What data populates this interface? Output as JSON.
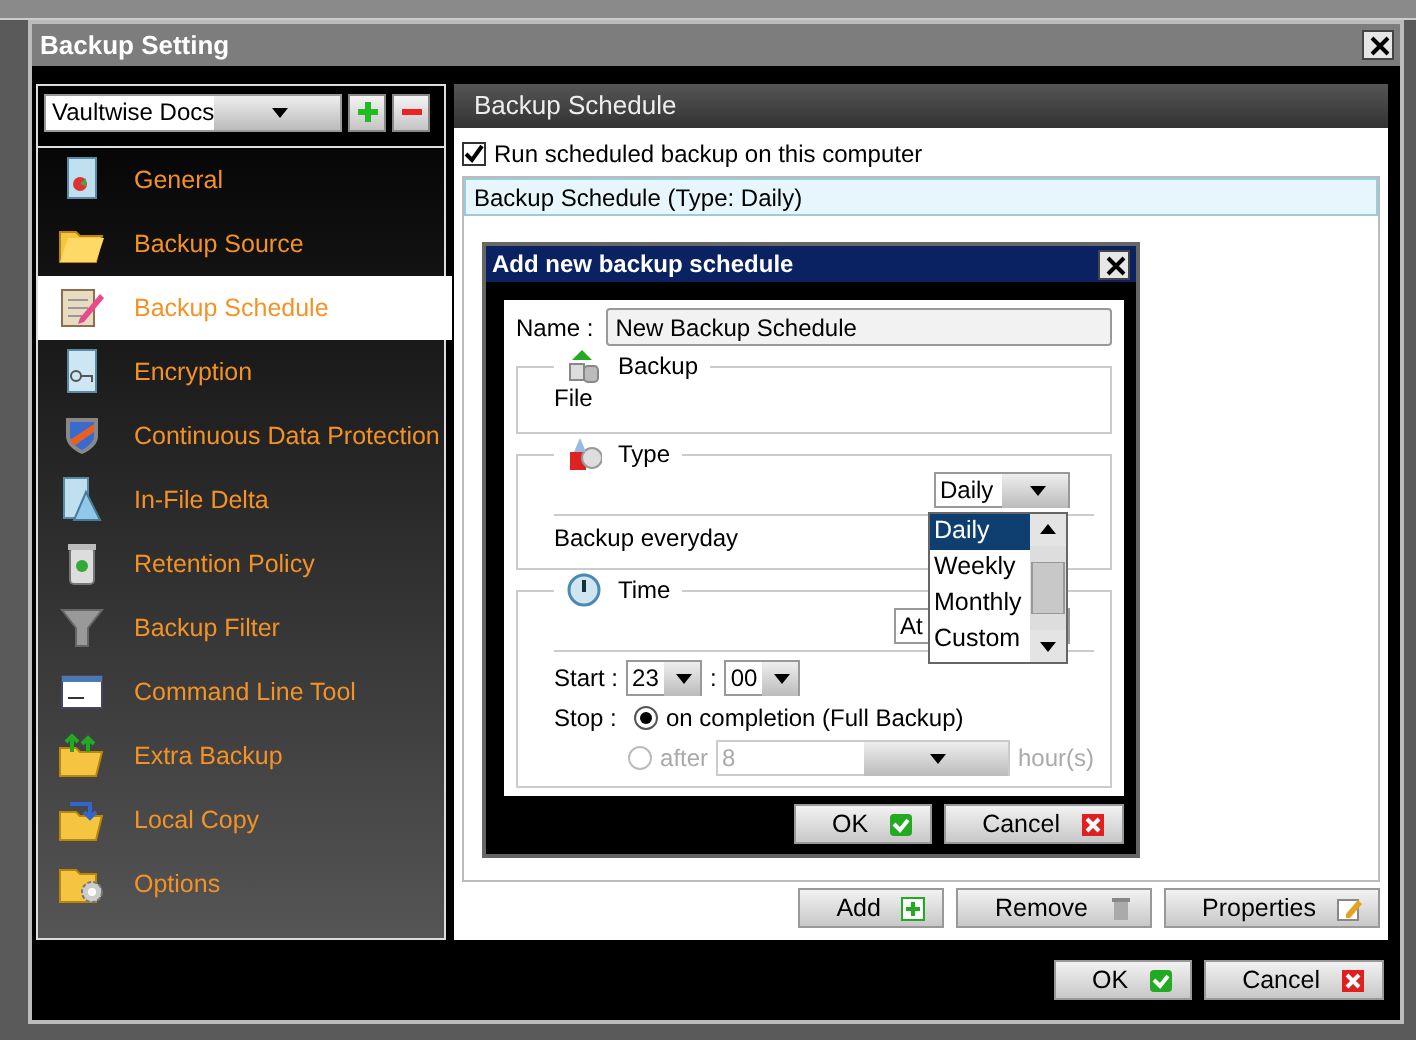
{
  "window": {
    "title": "Backup Setting"
  },
  "profile_selector": {
    "value": "Vaultwise Docs"
  },
  "sidebar": {
    "items": [
      {
        "label": "General",
        "kind": "general",
        "selected": false
      },
      {
        "label": "Backup Source",
        "kind": "source",
        "selected": false
      },
      {
        "label": "Backup Schedule",
        "kind": "schedule",
        "selected": true
      },
      {
        "label": "Encryption",
        "kind": "encryption",
        "selected": false
      },
      {
        "label": "Continuous Data Protection",
        "kind": "cdp",
        "selected": false
      },
      {
        "label": "In-File Delta",
        "kind": "delta",
        "selected": false
      },
      {
        "label": "Retention Policy",
        "kind": "retention",
        "selected": false
      },
      {
        "label": "Backup Filter",
        "kind": "filter",
        "selected": false
      },
      {
        "label": "Command Line Tool",
        "kind": "cmd",
        "selected": false
      },
      {
        "label": "Extra Backup",
        "kind": "extra",
        "selected": false
      },
      {
        "label": "Local Copy",
        "kind": "copy",
        "selected": false
      },
      {
        "label": "Options",
        "kind": "options",
        "selected": false
      }
    ]
  },
  "panel": {
    "title": "Backup Schedule",
    "run_scheduled": {
      "label": "Run scheduled backup on this computer",
      "checked": true
    },
    "schedules": [
      {
        "label": "Backup Schedule (Type: Daily)",
        "selected": true
      }
    ],
    "buttons": [
      {
        "label": "Add",
        "kind": "add"
      },
      {
        "label": "Remove",
        "kind": "remove"
      },
      {
        "label": "Properties",
        "kind": "properties"
      }
    ]
  },
  "dialog": {
    "title": "Add new backup schedule",
    "name_label": "Name :",
    "name_value": "New Backup Schedule",
    "backup_section": {
      "title": "Backup",
      "value": "File"
    },
    "type_section": {
      "title": "Type",
      "value": "Daily",
      "description": "Backup everyday",
      "options": [
        {
          "label": "Daily",
          "selected": true
        },
        {
          "label": "Weekly",
          "selected": false
        },
        {
          "label": "Monthly",
          "selected": false
        },
        {
          "label": "Custom",
          "selected": false
        }
      ]
    },
    "time_section": {
      "title": "Time",
      "mode_value": "At",
      "start_label": "Start :",
      "start_hour": "23",
      "separator": ":",
      "start_minute": "00",
      "stop_label": "Stop :",
      "stop_options": [
        {
          "label": "on completion (Full Backup)",
          "selected": true,
          "disabled": false
        },
        {
          "label": "after",
          "selected": false,
          "disabled": true,
          "value": "8",
          "unit": "hour(s)"
        }
      ]
    },
    "buttons": [
      {
        "label": "OK",
        "kind": "ok"
      },
      {
        "label": "Cancel",
        "kind": "cancel"
      }
    ]
  },
  "buttons": [
    {
      "label": "OK",
      "kind": "ok"
    },
    {
      "label": "Cancel",
      "kind": "cancel"
    }
  ]
}
